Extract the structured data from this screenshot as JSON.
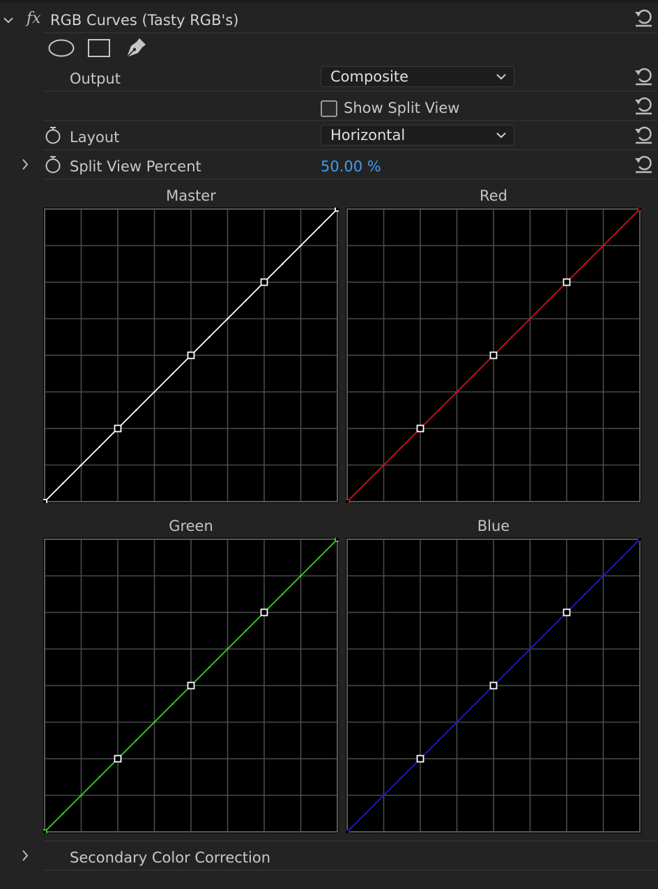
{
  "effect": {
    "title": "RGB Curves (Tasty RGB's)",
    "fx_label": "fx"
  },
  "rows": {
    "output": {
      "label": "Output",
      "value": "Composite"
    },
    "split_view": {
      "label": "Show Split View",
      "checked": false
    },
    "layout": {
      "label": "Layout",
      "value": "Horizontal"
    },
    "split_percent": {
      "label": "Split View Percent",
      "value": "50.00 %"
    }
  },
  "curves": [
    {
      "name": "Master",
      "color": "#ffffff",
      "points": [
        [
          0,
          0
        ],
        [
          0.25,
          0.25
        ],
        [
          0.5,
          0.5
        ],
        [
          0.75,
          0.75
        ],
        [
          1,
          1
        ]
      ]
    },
    {
      "name": "Red",
      "color": "#c8161c",
      "points": [
        [
          0,
          0
        ],
        [
          0.25,
          0.25
        ],
        [
          0.5,
          0.5
        ],
        [
          0.75,
          0.75
        ],
        [
          1,
          1
        ]
      ]
    },
    {
      "name": "Green",
      "color": "#38d12f",
      "points": [
        [
          0,
          0
        ],
        [
          0.25,
          0.25
        ],
        [
          0.5,
          0.5
        ],
        [
          0.75,
          0.75
        ],
        [
          1,
          1
        ]
      ]
    },
    {
      "name": "Blue",
      "color": "#1c1fc4",
      "points": [
        [
          0,
          0
        ],
        [
          0.25,
          0.25
        ],
        [
          0.5,
          0.5
        ],
        [
          0.75,
          0.75
        ],
        [
          1,
          1
        ]
      ]
    }
  ],
  "secondary": {
    "label": "Secondary Color Correction"
  },
  "icons": {
    "collapse": "chevron-down-icon",
    "expand": "chevron-right-icon",
    "reset": "reset-icon",
    "stopwatch": "stopwatch-icon",
    "ellipse": "ellipse-mask-icon",
    "rectangle": "rectangle-mask-icon",
    "pen": "pen-mask-icon"
  }
}
